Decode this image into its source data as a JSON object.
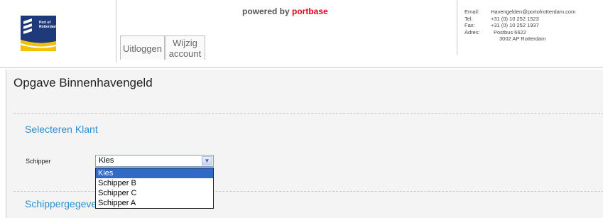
{
  "header": {
    "logo_text": "Port of Rotterdam",
    "powered_prefix": "powered by ",
    "powered_brand": "portbase",
    "buttons": {
      "logout": "Uitloggen",
      "account": "Wijzig account"
    },
    "contact": {
      "email_label": "Email:",
      "email": "Havengelden@portofrotterdam.com",
      "tel_label": "Tel:",
      "tel": "+31 (0) 10 252 1523",
      "fax_label": "Fax:",
      "fax": "+31 (0) 10 252 1937",
      "address_label": "Adres:",
      "address_line1": "Postbus 6622",
      "address_line2": "3002 AP  Rotterdam"
    }
  },
  "main": {
    "title": "Opgave Binnenhavengeld",
    "section1_title": "Selecteren Klant",
    "schipper_label": "Schipper",
    "schipper_select": {
      "value": "Kies",
      "options": [
        "Kies",
        "Schipper B",
        "Schipper C",
        "Schipper A"
      ]
    },
    "section2_title": "Schippergegevens"
  },
  "colors": {
    "accent_blue": "#2b8fd0",
    "brand_red": "#e3001b",
    "selection_blue": "#3169c6"
  }
}
